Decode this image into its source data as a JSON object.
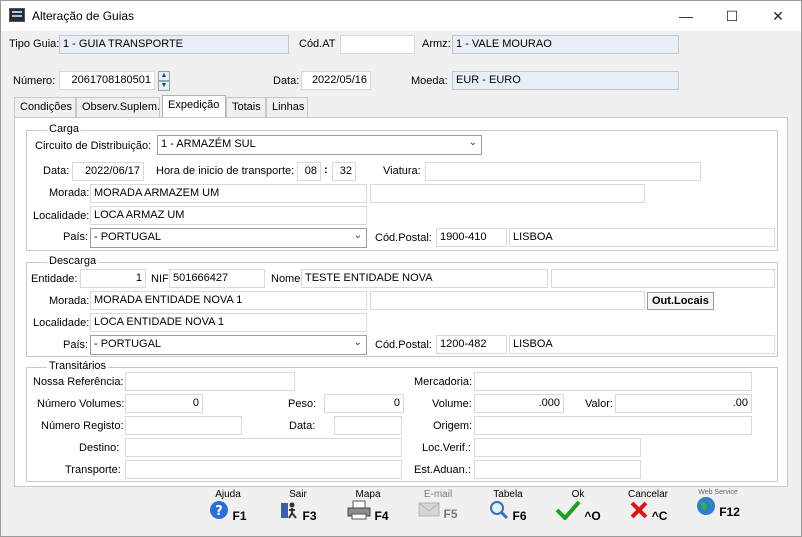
{
  "window": {
    "title": "Alteração de Guias"
  },
  "header": {
    "tipo_guia_label": "Tipo Guia:",
    "tipo_guia_value": "1 - GUIA TRANSPORTE",
    "cod_at_label": "Cód.AT",
    "cod_at_value": "",
    "armz_label": "Armz:",
    "armz_value": "1 - VALE MOURAO",
    "numero_label": "Número:",
    "numero_value": "2061708180501",
    "data_label": "Data:",
    "data_value": "2022/05/16",
    "moeda_label": "Moeda:",
    "moeda_value": "EUR - EURO"
  },
  "tabs": [
    {
      "label": "Condições"
    },
    {
      "label": "Observ.Suplem."
    },
    {
      "label": "Expedição"
    },
    {
      "label": "Totais"
    },
    {
      "label": "Linhas"
    }
  ],
  "carga": {
    "title": "Carga",
    "circuito_label": "Circuito de Distribuição:",
    "circuito_value": "1 - ARMAZÉM SUL",
    "data_label": "Data:",
    "data_value": "2022/06/17",
    "hora_label": "Hora de inicio de transporte:",
    "hora_h": "08",
    "hora_sep": ":",
    "hora_m": "32",
    "viatura_label": "Viatura:",
    "viatura_value": "",
    "morada_label": "Morada:",
    "morada_value": "MORADA ARMAZEM UM",
    "morada2_value": "",
    "localidade_label": "Localidade:",
    "localidade_value": "LOCA ARMAZ UM",
    "pais_label": "País:",
    "pais_value": "- PORTUGAL",
    "cp_label": "Cód.Postal:",
    "cp_value": "1900-410",
    "cp_local": "LISBOA"
  },
  "descarga": {
    "title": "Descarga",
    "entidade_label": "Entidade:",
    "entidade_value": "1",
    "nif_label": "NIF",
    "nif_value": "501666427",
    "nome_label": "Nome:",
    "nome_value": "TESTE ENTIDADE NOVA",
    "nome2_value": "",
    "morada_label": "Morada:",
    "morada_value": "MORADA ENTIDADE NOVA 1",
    "morada2_value": "",
    "out_locais": "Out.Locais",
    "localidade_label": "Localidade:",
    "localidade_value": "LOCA ENTIDADE NOVA 1",
    "pais_label": "País:",
    "pais_value": "- PORTUGAL",
    "cp_label": "Cód.Postal:",
    "cp_value": "1200-482",
    "cp_local": "LISBOA"
  },
  "transitarios": {
    "title": "Transitários",
    "nossa_ref_label": "Nossa Referência:",
    "nossa_ref_value": "",
    "mercadoria_label": "Mercadoria:",
    "mercadoria_value": "",
    "num_vol_label": "Número Volumes:",
    "num_vol_value": "0",
    "peso_label": "Peso:",
    "peso_value": "0",
    "volume_label": "Volume:",
    "volume_value": ".000",
    "valor_label": "Valor:",
    "valor_value": ".00",
    "num_reg_label": "Número Registo:",
    "num_reg_value": "",
    "data_label": "Data:",
    "data_value": "",
    "origem_label": "Origem:",
    "origem_value": "",
    "destino_label": "Destino:",
    "destino_value": "",
    "loc_verif_label": "Loc.Verif.:",
    "loc_verif_value": "",
    "transporte_label": "Transporte:",
    "transporte_value": "",
    "est_aduan_label": "Est.Aduan.:",
    "est_aduan_value": ""
  },
  "toolbar": [
    {
      "caption": "Ajuda",
      "key": "F1",
      "icon": "help-icon"
    },
    {
      "caption": "Sair",
      "key": "F3",
      "icon": "exit-icon"
    },
    {
      "caption": "Mapa",
      "key": "F4",
      "icon": "printer-icon"
    },
    {
      "caption": "E-mail",
      "key": "F5",
      "icon": "email-icon"
    },
    {
      "caption": "Tabela",
      "key": "F6",
      "icon": "magnifier-icon"
    },
    {
      "caption": "Ok",
      "key": "^O",
      "icon": "check-icon"
    },
    {
      "caption": "Cancelar",
      "key": "^C",
      "icon": "cross-icon"
    },
    {
      "caption": "Web Service",
      "key": "F12",
      "icon": "globe-icon"
    }
  ],
  "colors": {
    "readonly_bg": "#e8eef6",
    "ok_green": "#1fa01f",
    "cancel_red": "#d21a1a",
    "help_blue": "#2b6fd6"
  }
}
